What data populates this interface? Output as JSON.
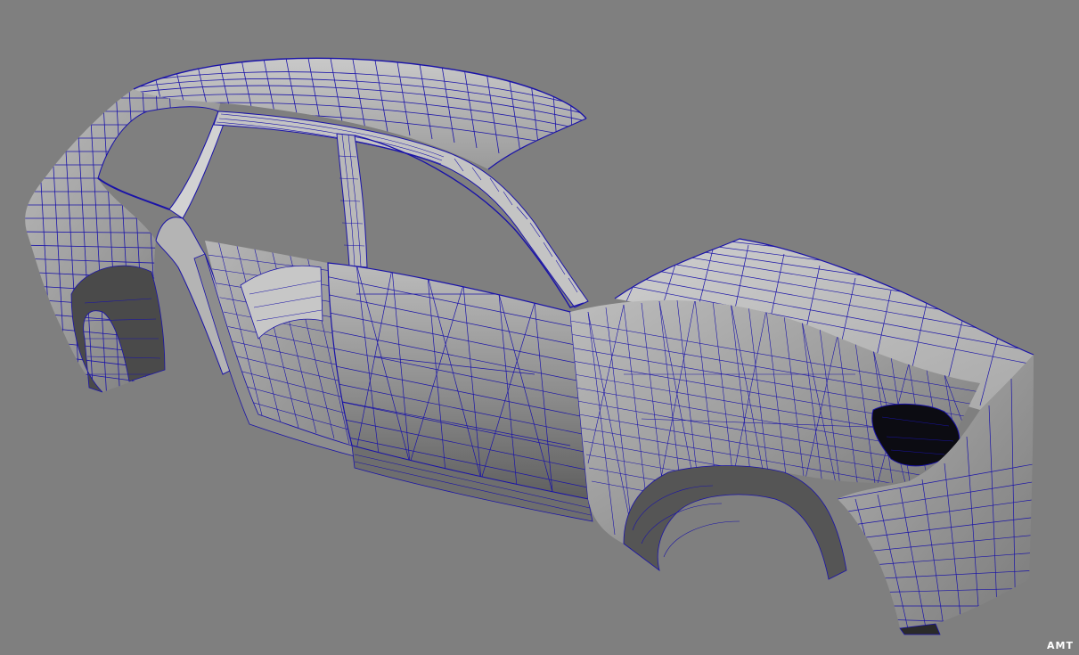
{
  "viewport": {
    "background_color": "#7f7f7f",
    "wire_color": "#1a13a8",
    "surface_color": "#a6a6a6",
    "surface_light": "#c9c9c9",
    "surface_dark": "#5f5f5f",
    "cavity_color": "#0c0c12"
  },
  "watermark": {
    "text": "AMT"
  }
}
